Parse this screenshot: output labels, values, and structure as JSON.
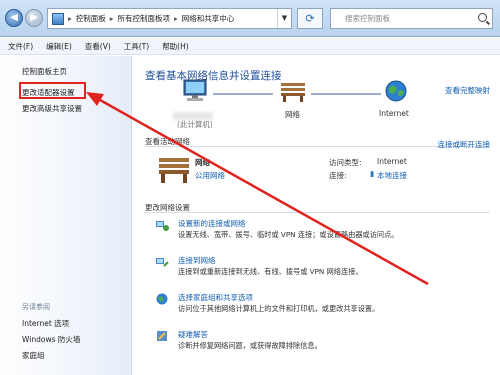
{
  "address_bar": {
    "crumbs": [
      "控制面板",
      "所有控制面板项",
      "网络和共享中心"
    ],
    "search_placeholder": "搜索控制面板"
  },
  "menu": [
    "文件(F)",
    "编辑(E)",
    "查看(V)",
    "工具(T)",
    "帮助(H)"
  ],
  "left_pane": {
    "links": [
      "控制面板主页",
      "更改适配器设置",
      "更改高级共享设置"
    ],
    "see_also_title": "另请参阅",
    "see_also": [
      "Internet 选项",
      "Windows 防火墙",
      "家庭组"
    ]
  },
  "main": {
    "title": "查看基本网络信息并设置连接",
    "full_map_link": "查看完整映射",
    "map": {
      "computer_label": "(此计算机)",
      "network_label": "网络",
      "internet_label": "Internet"
    },
    "active_networks_title": "查看活动网络",
    "connect_or_disconnect": "连接或断开连接",
    "network_name": "网络",
    "network_type": "公用网络",
    "access_type_label": "访问类型:",
    "access_type_value": "Internet",
    "connections_label": "连接:",
    "connections_value": "本地连接",
    "change_settings_title": "更改网络设置",
    "tasks": [
      {
        "title": "设置新的连接或网络",
        "desc": "设置无线、宽带、拨号、临时或 VPN 连接；或设置路由器或访问点。"
      },
      {
        "title": "连接到网络",
        "desc": "连接到或重新连接到无线、有线、拨号或 VPN 网络连接。"
      },
      {
        "title": "选择家庭组和共享选项",
        "desc": "访问位于其他网络计算机上的文件和打印机，或更改共享设置。"
      },
      {
        "title": "疑难解答",
        "desc": "诊断并修复网络问题，或获得故障排除信息。"
      }
    ]
  },
  "colors": {
    "link": "#0f5db0",
    "title_blue": "#1f4e9c",
    "annotation_red": "#e0231f"
  }
}
